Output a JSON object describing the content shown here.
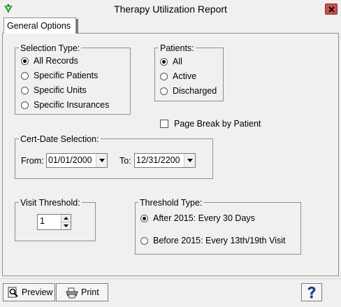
{
  "window": {
    "title": "Therapy Utilization Report",
    "icon": "app-icon",
    "close_icon": "close-icon"
  },
  "tabs": [
    {
      "label": "General Options",
      "selected": true
    }
  ],
  "selection_type": {
    "legend": "Selection Type:",
    "options": [
      "All Records",
      "Specific Patients",
      "Specific Units",
      "Specific Insurances"
    ],
    "selected": "All Records"
  },
  "patients": {
    "legend": "Patients:",
    "options": [
      "All",
      "Active",
      "Discharged"
    ],
    "selected": "All"
  },
  "page_break": {
    "label": "Page Break by Patient",
    "checked": false
  },
  "cert_date": {
    "legend": "Cert-Date Selection:",
    "from_label": "From:",
    "from_value": "01/01/2000",
    "to_label": "To:",
    "to_value": "12/31/2200"
  },
  "visit_threshold": {
    "legend": "Visit Threshold:",
    "value": "1"
  },
  "threshold_type": {
    "legend": "Threshold Type:",
    "options": [
      "After 2015: Every 30 Days",
      "Before 2015: Every 13th/19th Visit"
    ],
    "selected": "After 2015: Every 30 Days"
  },
  "toolbar": {
    "preview_label": "Preview",
    "print_label": "Print",
    "preview_icon": "magnifier-page-icon",
    "print_icon": "printer-icon",
    "help_icon": "help-icon"
  },
  "colors": {
    "close_button": "#c75050",
    "help_icon": "#1f4fa8",
    "app_icon": "#3aa53a"
  }
}
